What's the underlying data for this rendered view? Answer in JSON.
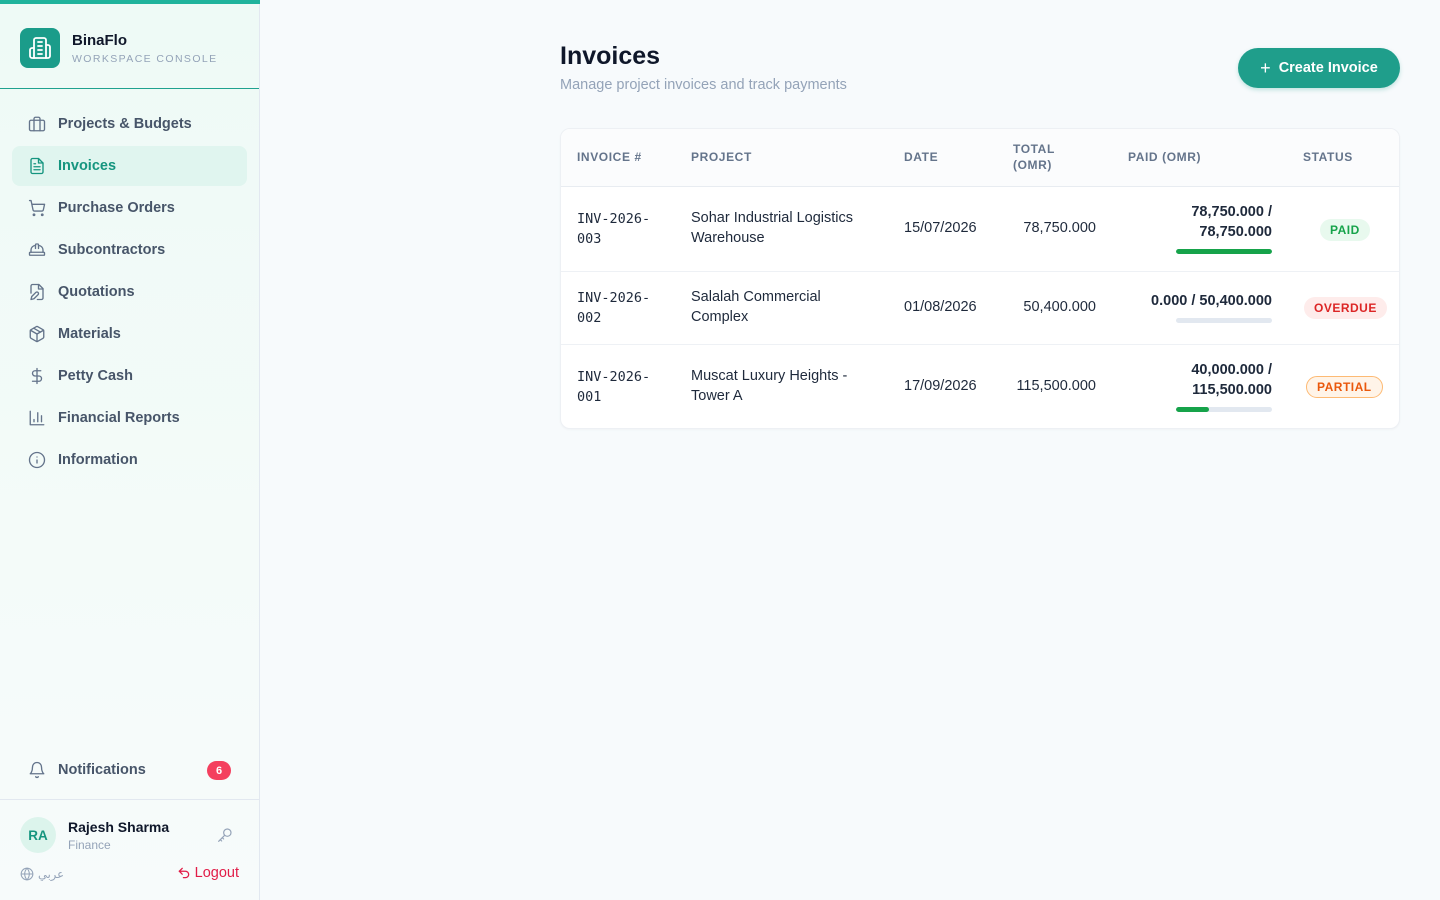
{
  "brand": {
    "name": "BinaFlo",
    "subtitle": "WORKSPACE CONSOLE"
  },
  "sidebar": {
    "items": [
      {
        "label": "Projects & Budgets",
        "icon": "briefcase-icon",
        "active": false
      },
      {
        "label": "Invoices",
        "icon": "file-text-icon",
        "active": true
      },
      {
        "label": "Purchase Orders",
        "icon": "cart-icon",
        "active": false
      },
      {
        "label": "Subcontractors",
        "icon": "hard-hat-icon",
        "active": false
      },
      {
        "label": "Quotations",
        "icon": "edit-file-icon",
        "active": false
      },
      {
        "label": "Materials",
        "icon": "package-icon",
        "active": false
      },
      {
        "label": "Petty Cash",
        "icon": "dollar-icon",
        "active": false
      },
      {
        "label": "Financial Reports",
        "icon": "bar-chart-icon",
        "active": false
      },
      {
        "label": "Information",
        "icon": "info-icon",
        "active": false
      }
    ],
    "notifications": {
      "label": "Notifications",
      "count": "6"
    }
  },
  "user": {
    "initials": "RA",
    "name": "Rajesh Sharma",
    "role": "Finance",
    "language": "عربي",
    "logout": "Logout"
  },
  "header": {
    "title": "Invoices",
    "subtitle": "Manage project invoices and track payments",
    "create_label": "Create Invoice"
  },
  "table": {
    "columns": [
      "INVOICE #",
      "PROJECT",
      "DATE",
      "TOTAL (OMR)",
      "PAID (OMR)",
      "STATUS"
    ],
    "rows": [
      {
        "invoice_line1": "INV-2026-",
        "invoice_line2": "003",
        "project_line1": "Sohar Industrial Logistics",
        "project_line2": "Warehouse",
        "date": "15/07/2026",
        "total": "78,750.000",
        "paid_line1": "78,750.000 /",
        "paid_line2": "78,750.000",
        "paid_fraction": 1.0,
        "status": "PAID"
      },
      {
        "invoice_line1": "INV-2026-",
        "invoice_line2": "002",
        "project_line1": "Salalah Commercial",
        "project_line2": "Complex",
        "date": "01/08/2026",
        "total": "50,400.000",
        "paid_line1": "0.000 / 50,400.000",
        "paid_line2": "",
        "paid_fraction": 0.0,
        "status": "OVERDUE"
      },
      {
        "invoice_line1": "INV-2026-",
        "invoice_line2": "001",
        "project_line1": "Muscat Luxury Heights -",
        "project_line2": "Tower A",
        "date": "17/09/2026",
        "total": "115,500.000",
        "paid_line1": "40,000.000 /",
        "paid_line2": "115,500.000",
        "paid_fraction": 0.3463,
        "status": "PARTIAL"
      }
    ]
  },
  "colors": {
    "accent": "#1f9e8b",
    "paid": "#16a34a",
    "overdue": "#dc2626",
    "partial": "#ea580c"
  }
}
